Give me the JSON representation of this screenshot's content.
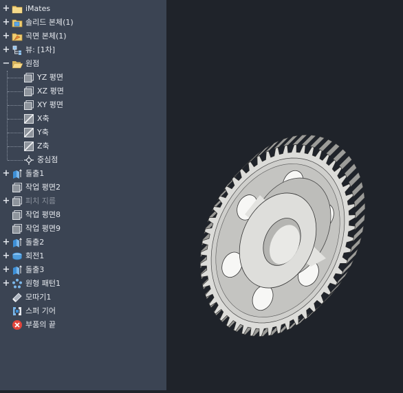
{
  "tree": {
    "items": [
      {
        "label": "iMates",
        "icon": "folder-icon",
        "expander": "+"
      },
      {
        "label": "솔리드 본체(1)",
        "icon": "solid-bodies-folder-icon",
        "expander": "+"
      },
      {
        "label": "곡면 본체(1)",
        "icon": "surface-bodies-folder-icon",
        "expander": "+"
      },
      {
        "label": "뷰: [1차]",
        "icon": "view-rep-icon",
        "expander": "+"
      },
      {
        "label": "원점",
        "icon": "open-folder-icon",
        "expander": "−"
      },
      {
        "label": "YZ 평면",
        "icon": "work-plane-icon",
        "expander": ""
      },
      {
        "label": "XZ 평면",
        "icon": "work-plane-icon",
        "expander": ""
      },
      {
        "label": "XY 평면",
        "icon": "work-plane-icon",
        "expander": ""
      },
      {
        "label": "X축",
        "icon": "work-axis-icon",
        "expander": ""
      },
      {
        "label": "Y축",
        "icon": "work-axis-icon",
        "expander": ""
      },
      {
        "label": "Z축",
        "icon": "work-axis-icon",
        "expander": ""
      },
      {
        "label": "중심점",
        "icon": "center-point-icon",
        "expander": ""
      },
      {
        "label": "돌출1",
        "icon": "extrude-icon",
        "expander": "+"
      },
      {
        "label": "작업 평면2",
        "icon": "work-plane-icon",
        "expander": ""
      },
      {
        "label": "피치 지름",
        "icon": "work-plane-icon",
        "expander": "+"
      },
      {
        "label": "작업 평면8",
        "icon": "work-plane-icon",
        "expander": ""
      },
      {
        "label": "작업 평면9",
        "icon": "work-plane-icon",
        "expander": ""
      },
      {
        "label": "돌출2",
        "icon": "extrude-icon",
        "expander": "+"
      },
      {
        "label": "회전1",
        "icon": "revolve-icon",
        "expander": "+"
      },
      {
        "label": "돌출3",
        "icon": "extrude-icon",
        "expander": "+"
      },
      {
        "label": "원형 패턴1",
        "icon": "circular-pattern-icon",
        "expander": "+"
      },
      {
        "label": "모따기1",
        "icon": "chamfer-icon",
        "expander": ""
      },
      {
        "label": "스퍼 기어",
        "icon": "spur-gear-icon",
        "expander": ""
      },
      {
        "label": "부품의 끝",
        "icon": "end-of-part-icon",
        "expander": ""
      }
    ]
  },
  "colors": {
    "panel": "#3b4453",
    "viewport": "#1f232a",
    "text": "#e6e9ee",
    "dim_text": "#8b929d",
    "folder": "#f2cf72",
    "body_blue": "#7bb7ea",
    "end_red": "#e0443c",
    "gear_face": "#d9d9d6"
  }
}
